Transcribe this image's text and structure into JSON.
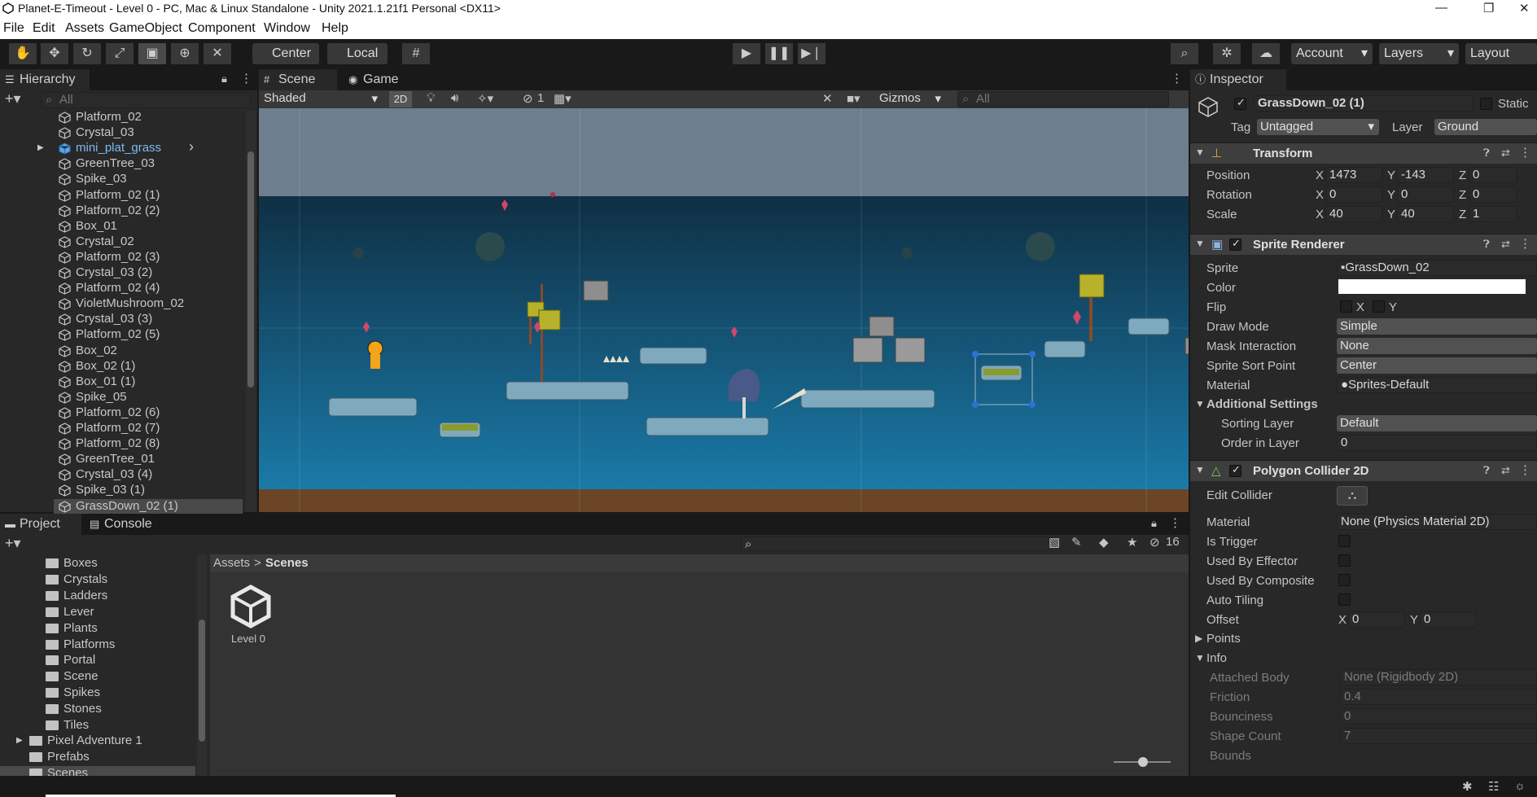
{
  "window": {
    "title": "Planet-E-Timeout - Level 0 - PC, Mac & Linux Standalone - Unity 2021.1.21f1 Personal <DX11>",
    "minimize": "—",
    "maximize": "❐",
    "close": "✕"
  },
  "menu": [
    "File",
    "Edit",
    "Assets",
    "GameObject",
    "Component",
    "Window",
    "Help"
  ],
  "toolbar": {
    "pivot": "Center",
    "space": "Local",
    "account": "Account",
    "layers": "Layers",
    "layout": "Layout"
  },
  "hierarchy": {
    "tab": "Hierarchy",
    "search_placeholder": "All",
    "items": [
      {
        "name": "Platform_02",
        "prefab": false
      },
      {
        "name": "Crystal_03",
        "prefab": false
      },
      {
        "name": "mini_plat_grass",
        "prefab": true
      },
      {
        "name": "GreenTree_03",
        "prefab": false
      },
      {
        "name": "Spike_03",
        "prefab": false
      },
      {
        "name": "Platform_02 (1)",
        "prefab": false
      },
      {
        "name": "Platform_02 (2)",
        "prefab": false
      },
      {
        "name": "Box_01",
        "prefab": false
      },
      {
        "name": "Crystal_02",
        "prefab": false
      },
      {
        "name": "Platform_02 (3)",
        "prefab": false
      },
      {
        "name": "Crystal_03 (2)",
        "prefab": false
      },
      {
        "name": "Platform_02 (4)",
        "prefab": false
      },
      {
        "name": "VioletMushroom_02",
        "prefab": false
      },
      {
        "name": "Crystal_03 (3)",
        "prefab": false
      },
      {
        "name": "Platform_02 (5)",
        "prefab": false
      },
      {
        "name": "Box_02",
        "prefab": false
      },
      {
        "name": "Box_02 (1)",
        "prefab": false
      },
      {
        "name": "Box_01 (1)",
        "prefab": false
      },
      {
        "name": "Spike_05",
        "prefab": false
      },
      {
        "name": "Platform_02 (6)",
        "prefab": false
      },
      {
        "name": "Platform_02 (7)",
        "prefab": false
      },
      {
        "name": "Platform_02 (8)",
        "prefab": false
      },
      {
        "name": "GreenTree_01",
        "prefab": false
      },
      {
        "name": "Crystal_03 (4)",
        "prefab": false
      },
      {
        "name": "Spike_03 (1)",
        "prefab": false
      },
      {
        "name": "GrassDown_02 (1)",
        "prefab": false,
        "selected": true
      }
    ]
  },
  "scene": {
    "tab_scene": "Scene",
    "tab_game": "Game",
    "shading": "Shaded",
    "mode_2d": "2D",
    "hidden_count": "1",
    "gizmos": "Gizmos",
    "search_placeholder": "All"
  },
  "project": {
    "tab_project": "Project",
    "tab_console": "Console",
    "breadcrumb_root": "Assets",
    "breadcrumb_sep": ">",
    "breadcrumb_current": "Scenes",
    "hidden_count": "16",
    "folders": [
      {
        "name": "Boxes"
      },
      {
        "name": "Crystals"
      },
      {
        "name": "Ladders"
      },
      {
        "name": "Lever"
      },
      {
        "name": "Plants"
      },
      {
        "name": "Platforms"
      },
      {
        "name": "Portal"
      },
      {
        "name": "Scene"
      },
      {
        "name": "Spikes"
      },
      {
        "name": "Stones"
      },
      {
        "name": "Tiles"
      }
    ],
    "top_folders": [
      {
        "name": "Pixel Adventure 1"
      },
      {
        "name": "Prefabs"
      },
      {
        "name": "Scenes",
        "selected": true
      }
    ],
    "asset_name": "Level 0"
  },
  "inspector": {
    "tab": "Inspector",
    "object_name": "GrassDown_02 (1)",
    "static": "Static",
    "tag_label": "Tag",
    "tag_value": "Untagged",
    "layer_label": "Layer",
    "layer_value": "Ground",
    "transform": {
      "title": "Transform",
      "rows": [
        {
          "label": "Position",
          "x": "1473",
          "y": "-143",
          "z": "0"
        },
        {
          "label": "Rotation",
          "x": "0",
          "y": "0",
          "z": "0"
        },
        {
          "label": "Scale",
          "x": "40",
          "y": "40",
          "z": "1"
        }
      ]
    },
    "sprite_renderer": {
      "title": "Sprite Renderer",
      "sprite_label": "Sprite",
      "sprite_value": "GrassDown_02",
      "color_label": "Color",
      "flip_label": "Flip",
      "flip_x": "X",
      "flip_y": "Y",
      "draw_mode_label": "Draw Mode",
      "draw_mode_value": "Simple",
      "mask_label": "Mask Interaction",
      "mask_value": "None",
      "sort_point_label": "Sprite Sort Point",
      "sort_point_value": "Center",
      "material_label": "Material",
      "material_value": "Sprites-Default",
      "additional": "Additional Settings",
      "sorting_layer_label": "Sorting Layer",
      "sorting_layer_value": "Default",
      "order_label": "Order in Layer",
      "order_value": "0"
    },
    "polygon_collider": {
      "title": "Polygon Collider 2D",
      "edit_label": "Edit Collider",
      "material_label": "Material",
      "material_value": "None (Physics Material 2D)",
      "is_trigger": "Is Trigger",
      "used_by_effector": "Used By Effector",
      "used_by_composite": "Used By Composite",
      "auto_tiling": "Auto Tiling",
      "offset_label": "Offset",
      "offset_x": "0",
      "offset_y": "0",
      "points": "Points",
      "info": "Info",
      "attached_body_label": "Attached Body",
      "attached_body_value": "None (Rigidbody 2D)",
      "friction_label": "Friction",
      "friction_value": "0.4",
      "bounciness_label": "Bounciness",
      "bounciness_value": "0",
      "shape_count_label": "Shape Count",
      "shape_count_value": "7",
      "bounds_label": "Bounds"
    }
  },
  "colors": {
    "sky_top": "#6b7c8c",
    "sky_bottom": "#1a6e9c",
    "ground": "#6e4a2a",
    "platform": "#7fa9bd",
    "accent": "#2c5d87"
  }
}
